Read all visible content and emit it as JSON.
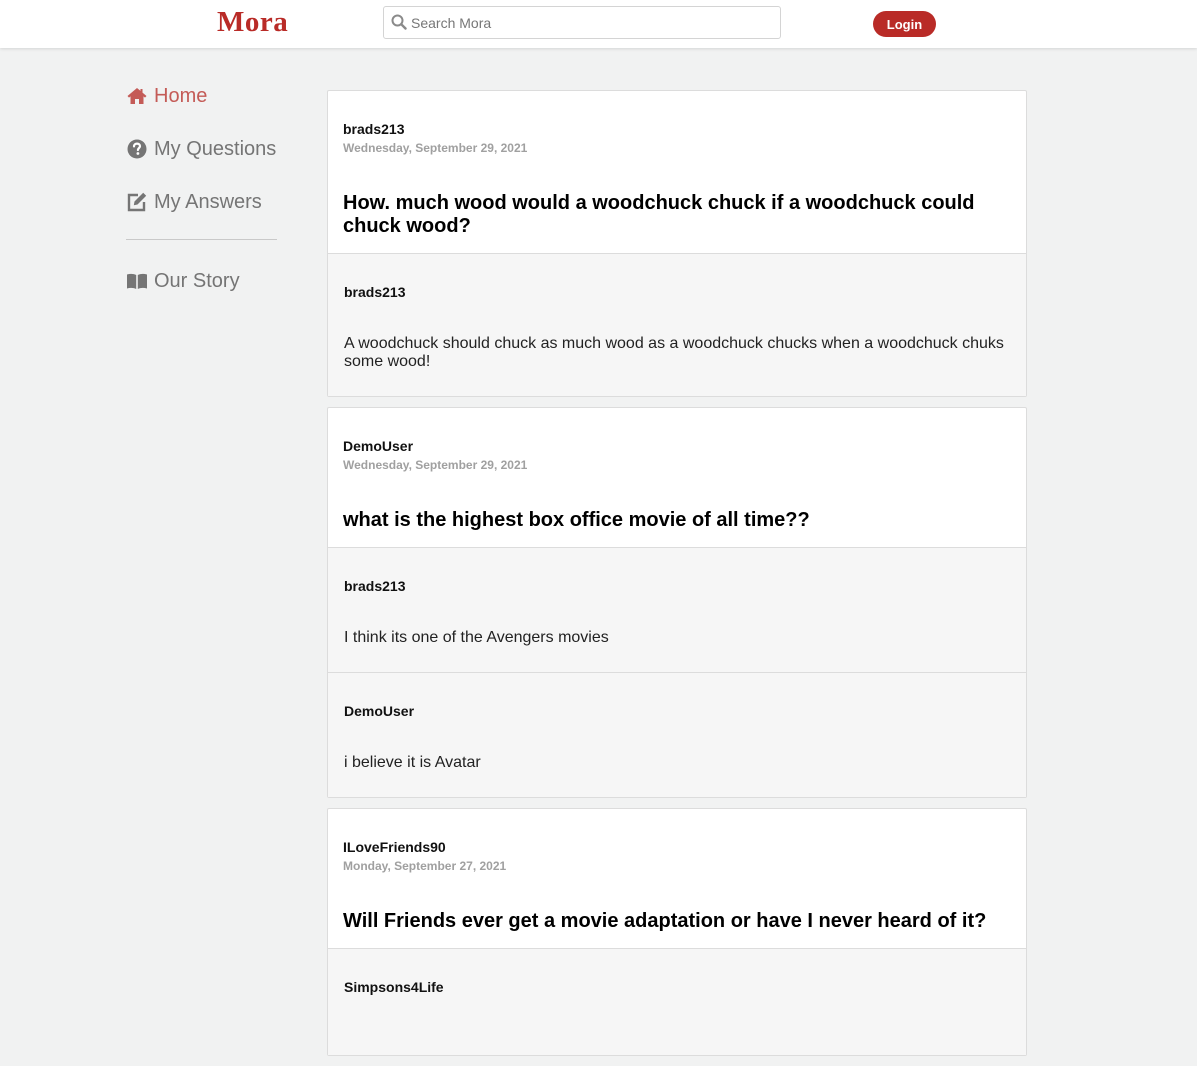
{
  "brand": {
    "name": "Mora",
    "accent": "#b92b27"
  },
  "search": {
    "placeholder": "Search Mora",
    "value": ""
  },
  "header": {
    "login_label": "Login"
  },
  "sidebar": {
    "items": [
      {
        "label": "Home",
        "icon": "home-icon",
        "active": true
      },
      {
        "label": "My Questions",
        "icon": "question-circle-icon",
        "active": false
      },
      {
        "label": "My Answers",
        "icon": "edit-icon",
        "active": false
      },
      {
        "label": "Our Story",
        "icon": "book-open-icon",
        "active": false
      }
    ]
  },
  "questions": [
    {
      "author": "brads213",
      "date": "Wednesday, September 29, 2021",
      "title": "How. much wood would a woodchuck chuck if a woodchuck could chuck wood?",
      "answers": [
        {
          "author": "brads213",
          "text": "A woodchuck should chuck as much wood as a woodchuck chucks when a woodchuck chuks some wood!"
        }
      ]
    },
    {
      "author": "DemoUser",
      "date": "Wednesday, September 29, 2021",
      "title": "what is the highest box office movie of all time??",
      "answers": [
        {
          "author": "brads213",
          "text": "I think its one of the Avengers movies"
        },
        {
          "author": "DemoUser",
          "text": "i believe it is Avatar"
        }
      ]
    },
    {
      "author": "ILoveFriends90",
      "date": "Monday, September 27, 2021",
      "title": "Will Friends ever get a movie adaptation or have I never heard of it?",
      "answers": [
        {
          "author": "Simpsons4Life",
          "text": ""
        }
      ]
    }
  ]
}
